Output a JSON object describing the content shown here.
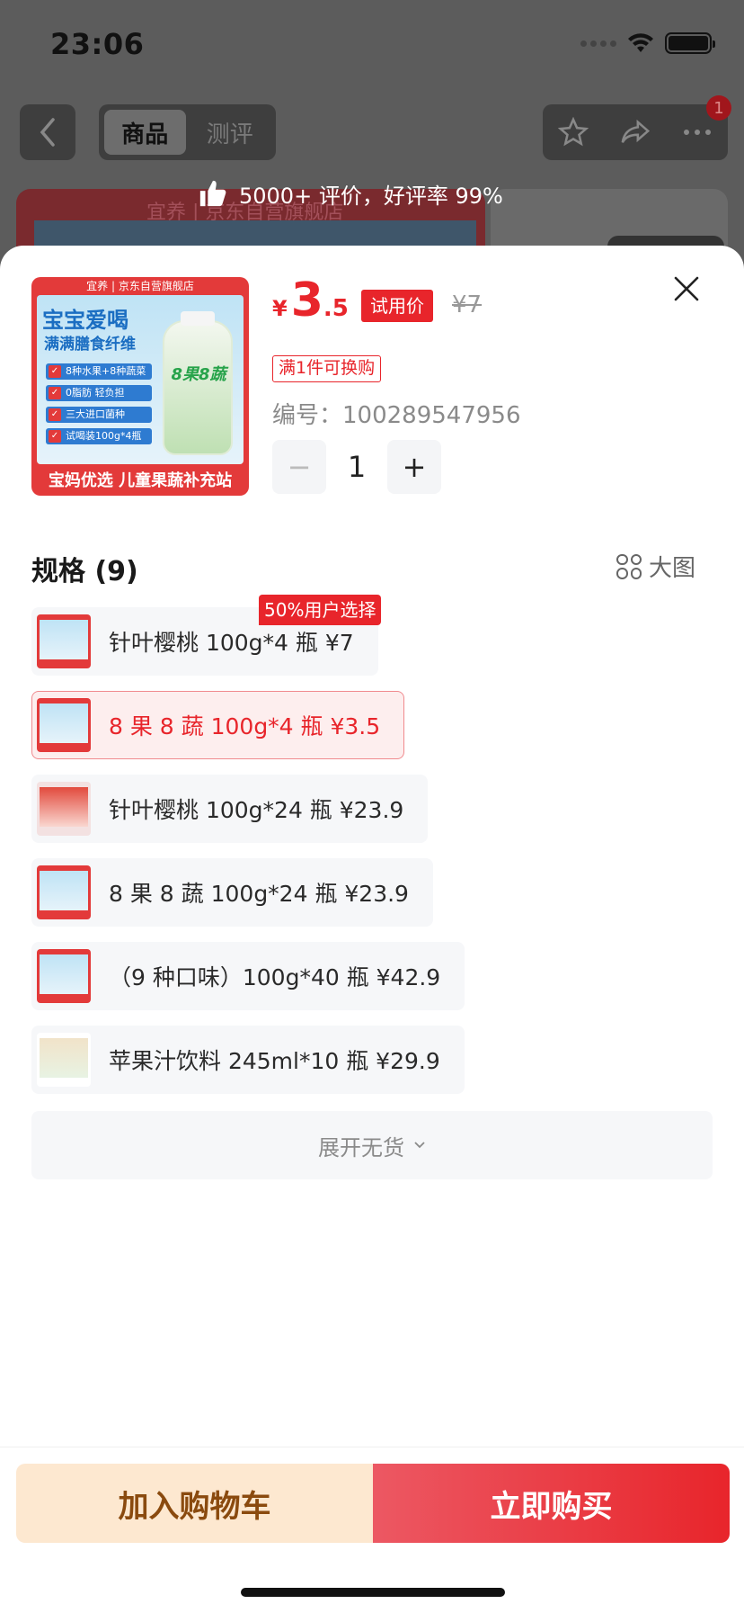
{
  "status_bar": {
    "time": "23:06"
  },
  "nav": {
    "back_icon": "chevron-left-icon",
    "tabs": [
      {
        "label": "商品"
      },
      {
        "label": "测评"
      }
    ],
    "actions": [
      "star-icon",
      "share-icon",
      "more-icon"
    ],
    "badge_count": "1"
  },
  "review_banner": "5000+ 评价，好评率 99%",
  "background": {
    "store_label": "宜养 | 京东自营旗舰店"
  },
  "product": {
    "image": {
      "top_strip": "宜养 | 京东自营旗舰店",
      "headline": "宝宝爱喝",
      "subhead": "满满膳食纤维",
      "checks": [
        "8种水果+8种蔬菜",
        "0脂肪 轻负担",
        "三大进口菌种",
        "试喝装100g*4瓶"
      ],
      "bottle_label": "8果8蔬",
      "bottom_strip": "宝妈优选 儿童果蔬补充站"
    },
    "currency": "¥",
    "price_int": "3",
    "price_dec": ".5",
    "trial_tag": "试用价",
    "orig_price": "¥7",
    "promo": "满1件可换购",
    "sku_no": "编号：100289547956",
    "quantity": "1",
    "minus": "−",
    "plus": "+"
  },
  "spec": {
    "title": "规格 (9)",
    "big_pic_label": "大图",
    "hot_tag": "50%用户选择",
    "items": [
      {
        "label": "针叶樱桃 100g*4 瓶   ¥7"
      },
      {
        "label": "8 果 8 蔬 100g*4 瓶   ¥3.5"
      },
      {
        "label": "针叶樱桃 100g*24 瓶   ¥23.9"
      },
      {
        "label": "8 果 8 蔬 100g*24 瓶   ¥23.9"
      },
      {
        "label": "（9 种口味）100g*40 瓶   ¥42.9"
      },
      {
        "label": "苹果汁饮料 245ml*10 瓶   ¥29.9"
      }
    ],
    "expand_label": "展开无货"
  },
  "actions": {
    "add_cart": "加入购物车",
    "buy_now": "立即购买"
  },
  "colors": {
    "accent": "#e8252b",
    "cart_bg": "#fde8d0",
    "cart_text": "#8a4a0e"
  }
}
